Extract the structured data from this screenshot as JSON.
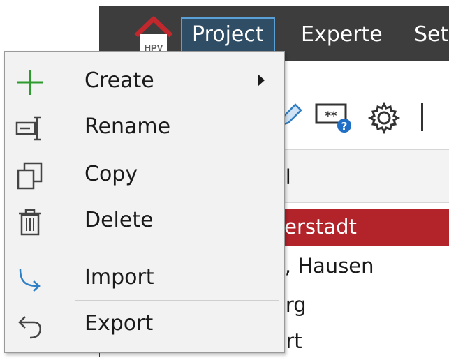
{
  "app": {
    "logo_text": "HPV",
    "menu": [
      "Project",
      "Experte",
      "Set"
    ],
    "column_header": "al",
    "rows": [
      "llerstadt",
      "k, Hausen",
      "erg",
      "urt"
    ]
  },
  "context_menu": {
    "items": [
      {
        "label": "Create",
        "icon": "plus-icon",
        "has_submenu": true
      },
      {
        "label": "Rename",
        "icon": "rename-icon",
        "has_submenu": false
      },
      {
        "label": "Copy",
        "icon": "copy-icon",
        "has_submenu": false
      },
      {
        "label": "Delete",
        "icon": "trash-icon",
        "has_submenu": false
      },
      {
        "label": "Import",
        "icon": "import-arrow-icon",
        "has_submenu": false
      },
      {
        "label": "Export",
        "icon": "export-arrow-icon",
        "has_submenu": false
      }
    ]
  },
  "colors": {
    "titlebar": "#3d3d3d",
    "selected_row": "#b3232a",
    "accent_blue": "#5aa0d6",
    "plus_green": "#2e9b2e",
    "logo_red": "#c0282d"
  }
}
